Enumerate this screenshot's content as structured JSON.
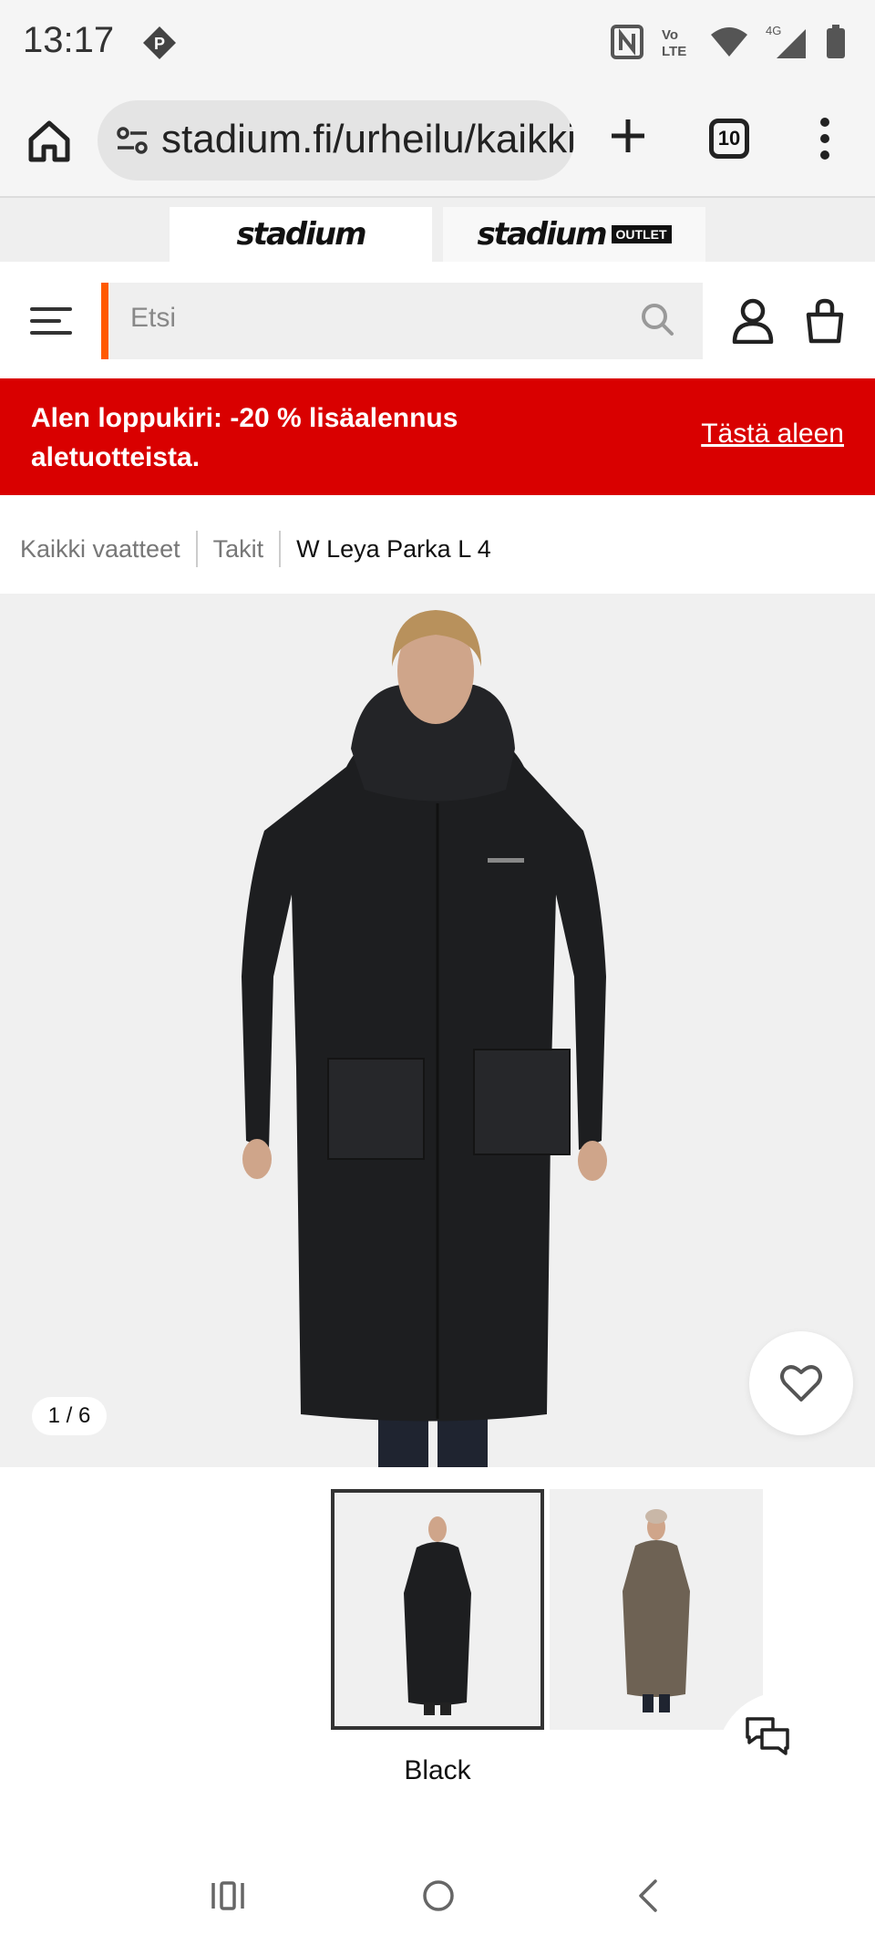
{
  "status_bar": {
    "time": "13:17",
    "network": "4G",
    "volte": "Vo LTE",
    "p_icon": "P"
  },
  "browser": {
    "url": "stadium.fi/urheilu/kaikki-vaatteet",
    "tab_count": "10"
  },
  "store_tabs": [
    {
      "label": "stadium"
    },
    {
      "label": "stadium",
      "badge": "OUTLET"
    }
  ],
  "search": {
    "placeholder": "Etsi"
  },
  "promo": {
    "text": "Alen loppukiri: -20 % lisäalennus aletuotteista.",
    "link": "Tästä aleen"
  },
  "breadcrumb": [
    "Kaikki vaatteet",
    "Takit",
    "W Leya Parka L 4"
  ],
  "gallery": {
    "counter": "1 / 6"
  },
  "variants": {
    "selected_color": "Black"
  },
  "colors": {
    "accent_orange": "#ff5a00",
    "promo_red": "#d90000"
  }
}
